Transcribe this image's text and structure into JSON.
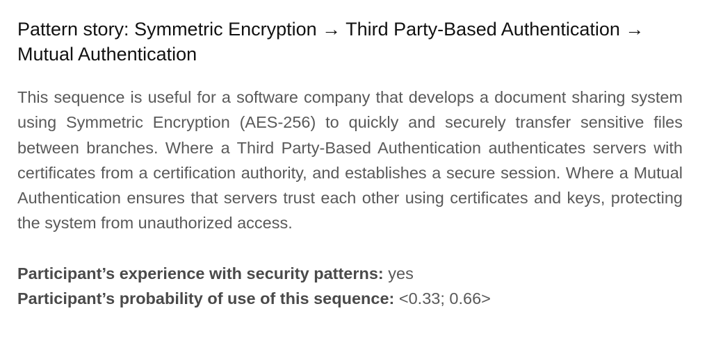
{
  "title": "Pattern story: Symmetric Encryption → Third Party-Based Authentication → Mutual Authentication",
  "description": "This sequence is useful for a software company that develops a document sharing system using Symmetric Encryption (AES-256) to quickly and securely transfer sensitive files between branches. Where a Third Party-Based Authentication authenticates servers with certificates from a certification authority, and establishes a secure session. Where a Mutual Authentication ensures that servers trust each other using certificates and keys, protecting the system from unauthorized access.",
  "facts": {
    "experience_label": "Participant’s experience with security patterns:",
    "experience_value": "yes",
    "probability_label": "Participant’s probability of use of this sequence:",
    "probability_value": "<0.33; 0.66>"
  }
}
